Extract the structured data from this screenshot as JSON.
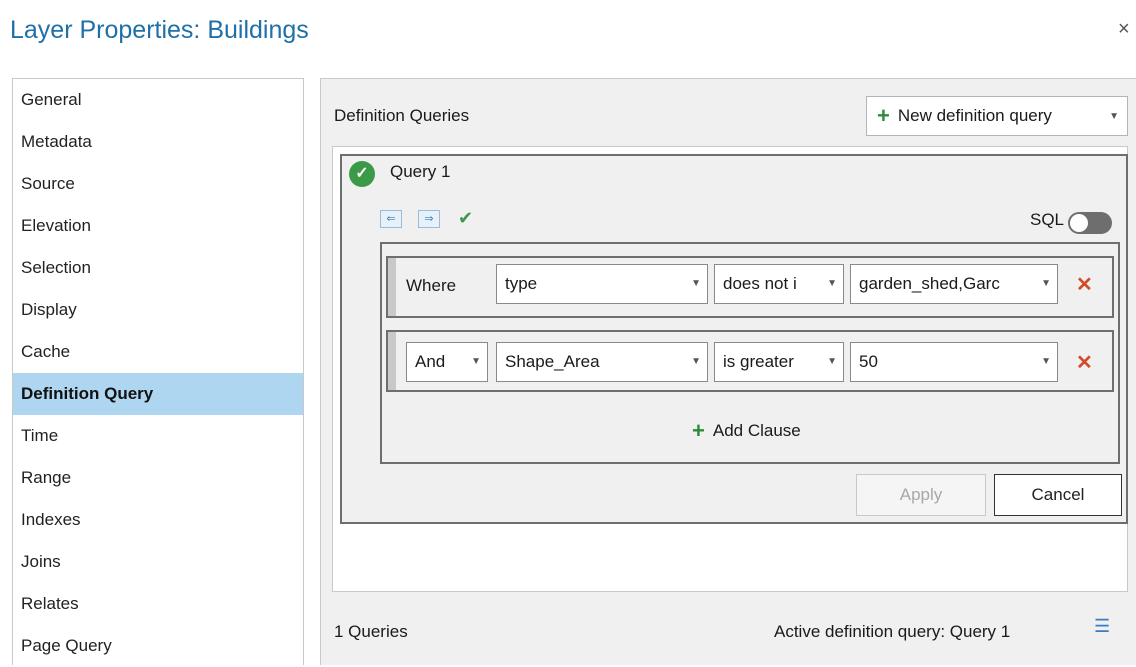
{
  "window": {
    "title": "Layer Properties: Buildings",
    "close_glyph": "×"
  },
  "sidebar": {
    "items": [
      {
        "label": "General"
      },
      {
        "label": "Metadata"
      },
      {
        "label": "Source"
      },
      {
        "label": "Elevation"
      },
      {
        "label": "Selection"
      },
      {
        "label": "Display"
      },
      {
        "label": "Cache"
      },
      {
        "label": "Definition Query",
        "active": true
      },
      {
        "label": "Time"
      },
      {
        "label": "Range"
      },
      {
        "label": "Indexes"
      },
      {
        "label": "Joins"
      },
      {
        "label": "Relates"
      },
      {
        "label": "Page Query"
      }
    ]
  },
  "main": {
    "section_label": "Definition Queries",
    "new_query_button": "New definition query",
    "query": {
      "name": "Query 1",
      "sql_label": "SQL",
      "sql_enabled": false,
      "clauses": [
        {
          "connector": "Where",
          "field": "type",
          "operator": "does not i",
          "value": "garden_shed,Garc"
        },
        {
          "connector": "And",
          "field": "Shape_Area",
          "operator": "is greater",
          "value": "50"
        }
      ],
      "add_clause_label": "Add Clause",
      "apply_label": "Apply",
      "cancel_label": "Cancel"
    },
    "footer": {
      "count_text": "1 Queries",
      "active_text": "Active definition query: Query 1"
    }
  },
  "colors": {
    "accent": "#1f6fa8",
    "active_item": "#aed6f1",
    "success": "#3a9a48",
    "delete": "#d24b2b"
  }
}
